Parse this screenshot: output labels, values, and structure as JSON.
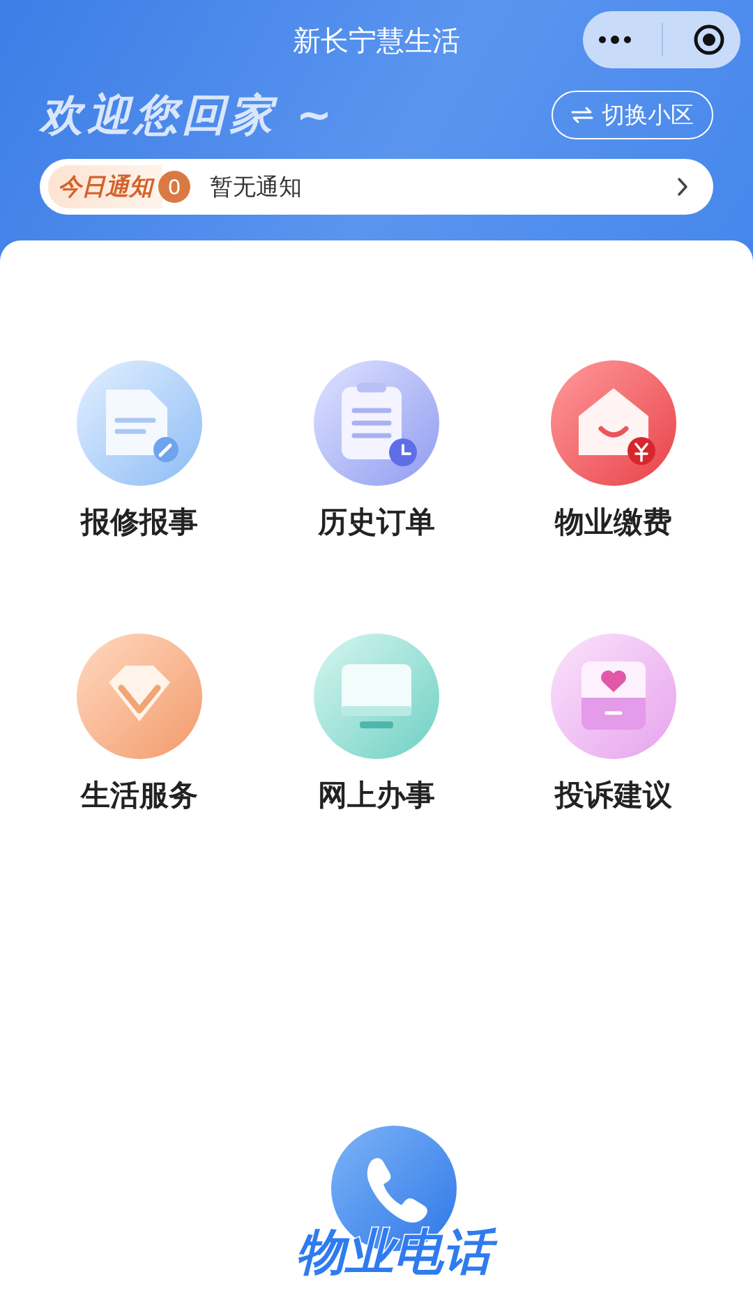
{
  "title": "新长宁慧生活",
  "welcome": "欢迎您回家 ~",
  "switch_button": {
    "label": "切换小区"
  },
  "notice": {
    "tag": "今日通知",
    "count": "0",
    "text": "暂无通知"
  },
  "services": [
    {
      "label": "报修报事",
      "kind": "document"
    },
    {
      "label": "历史订单",
      "kind": "clipboard"
    },
    {
      "label": "物业缴费",
      "kind": "house"
    },
    {
      "label": "生活服务",
      "kind": "diamond"
    },
    {
      "label": "网上办事",
      "kind": "monitor"
    },
    {
      "label": "投诉建议",
      "kind": "heartbox"
    }
  ],
  "hotline": {
    "label": "物业电话"
  }
}
